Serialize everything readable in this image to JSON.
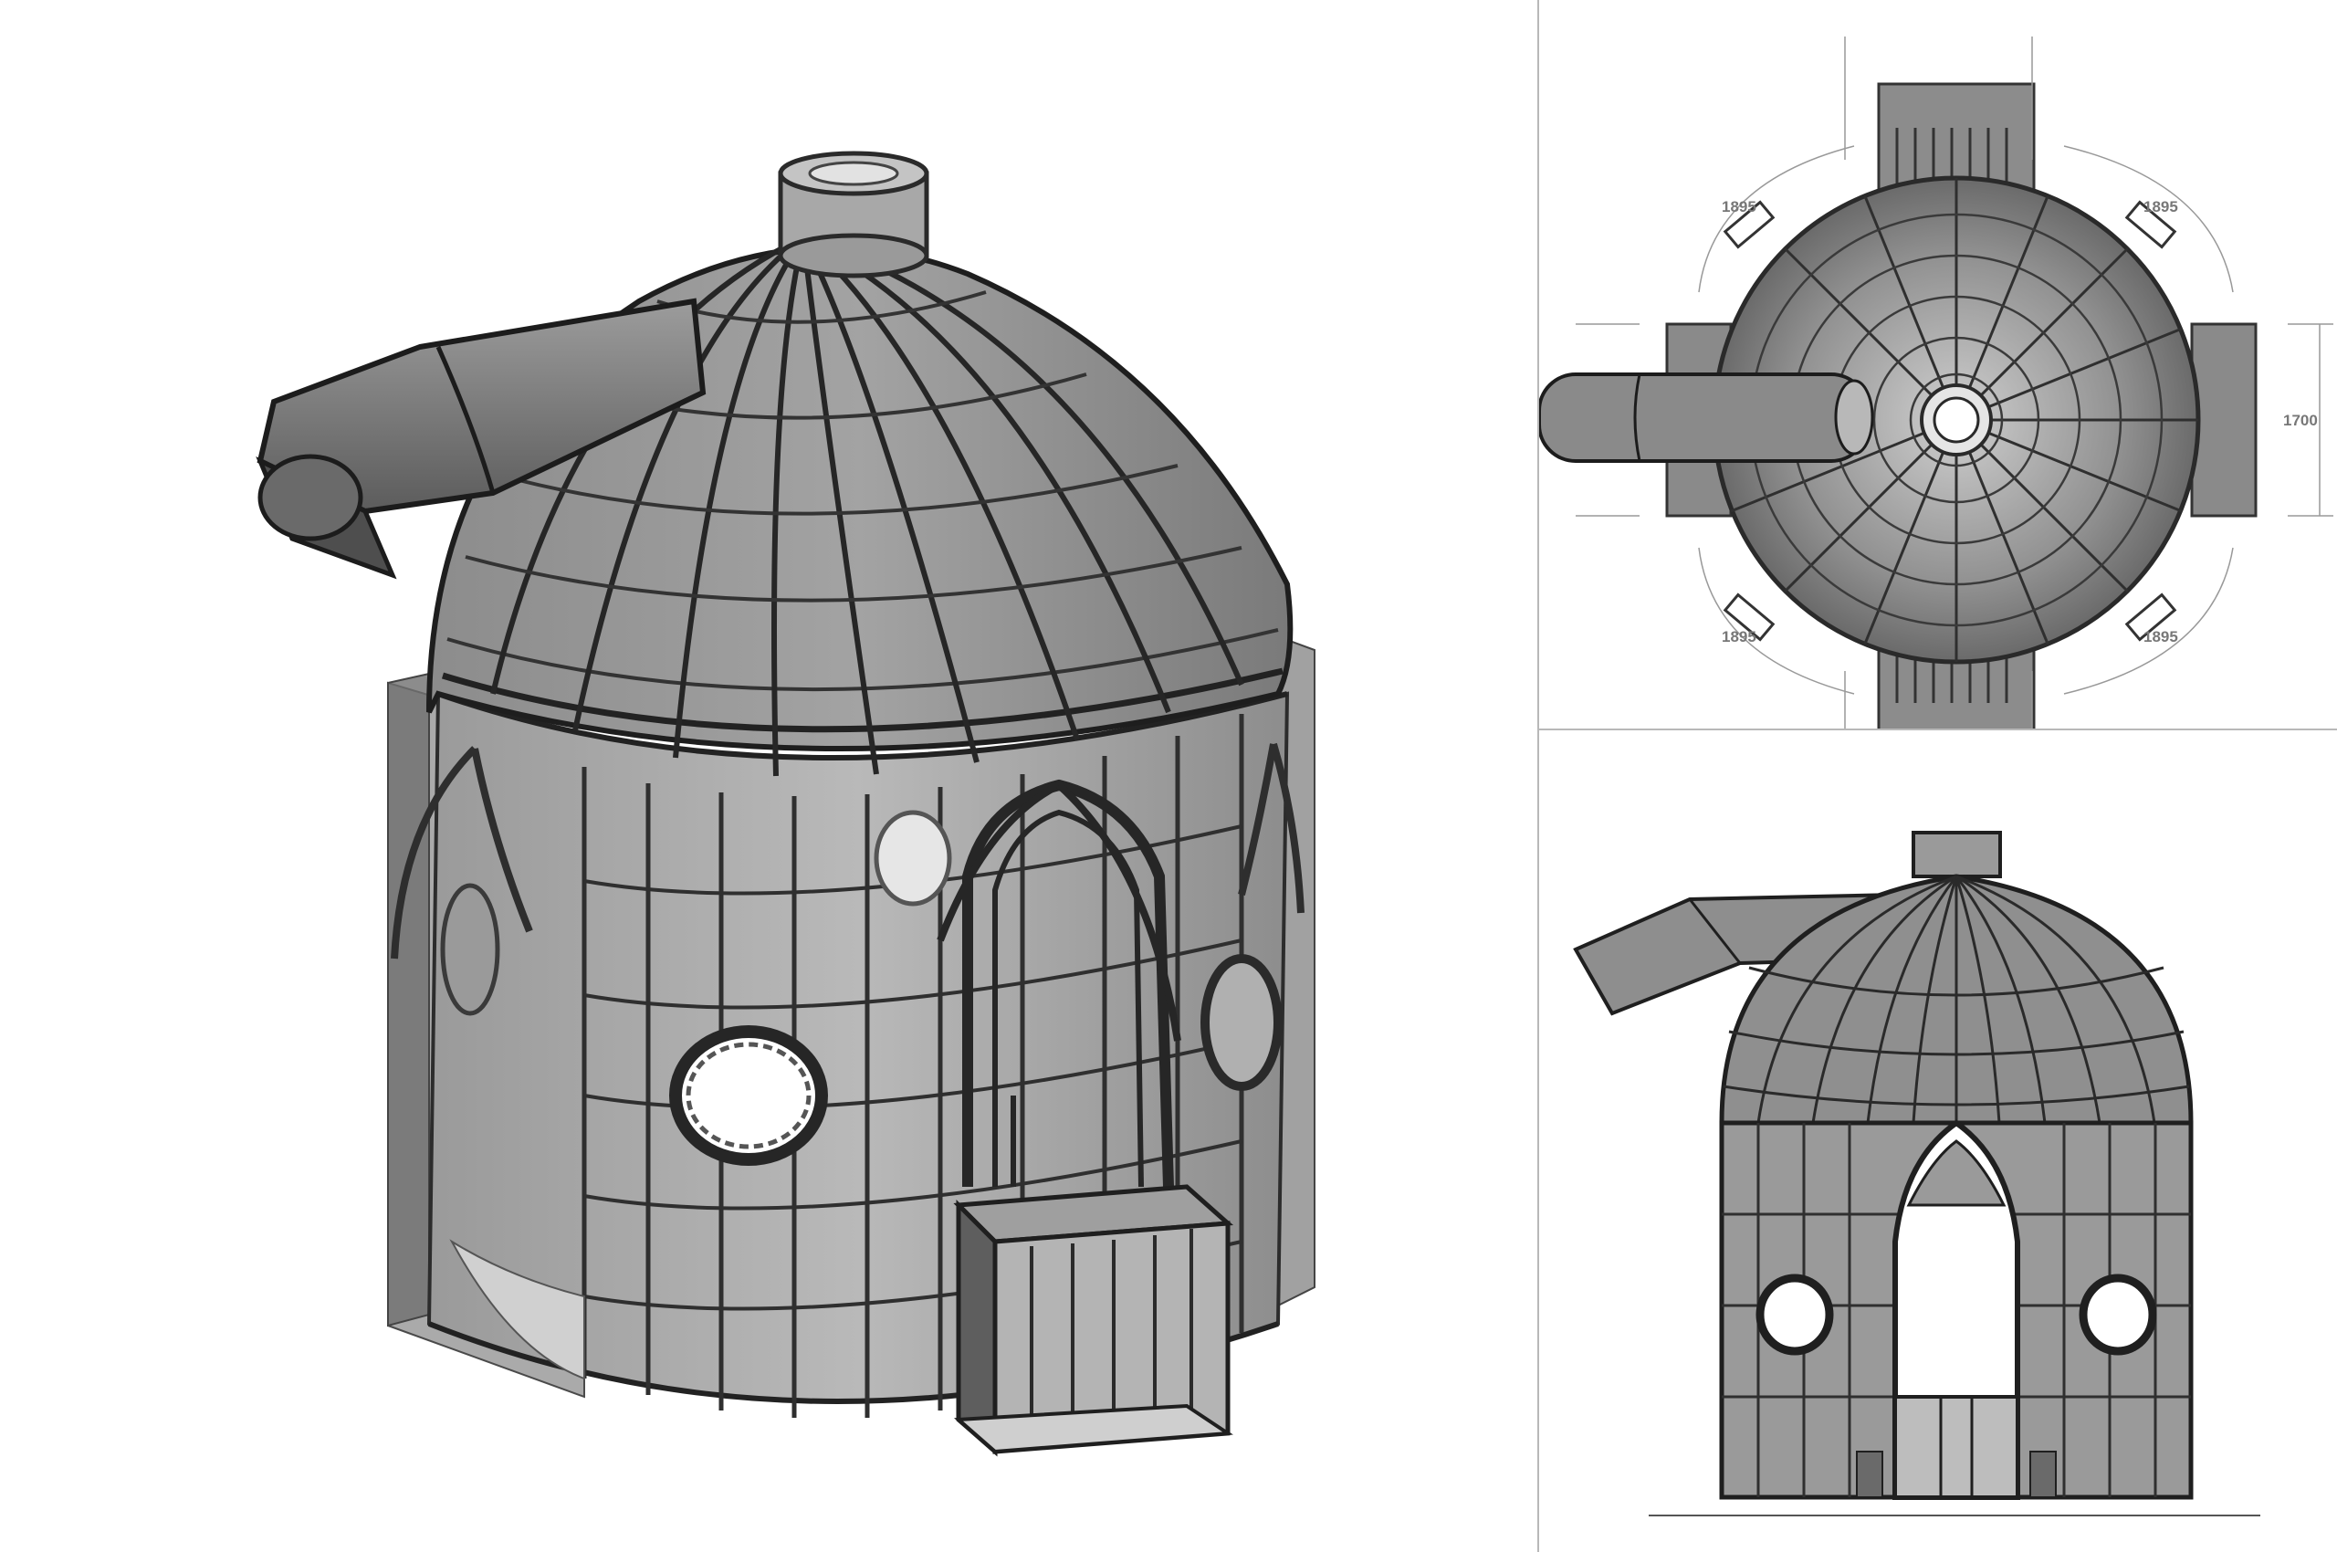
{
  "plan_view": {
    "dim_arc_label_tl": "1895",
    "dim_arc_label_tr": "1895",
    "dim_arc_label_bl": "1895",
    "dim_arc_label_br": "1895",
    "dim_height_label": "1700"
  },
  "colors": {
    "structure_dark": "#3a3a3a",
    "glass_grey": "#8a8a8a",
    "panel_grey": "#9a9a9a",
    "background": "#ffffff"
  }
}
